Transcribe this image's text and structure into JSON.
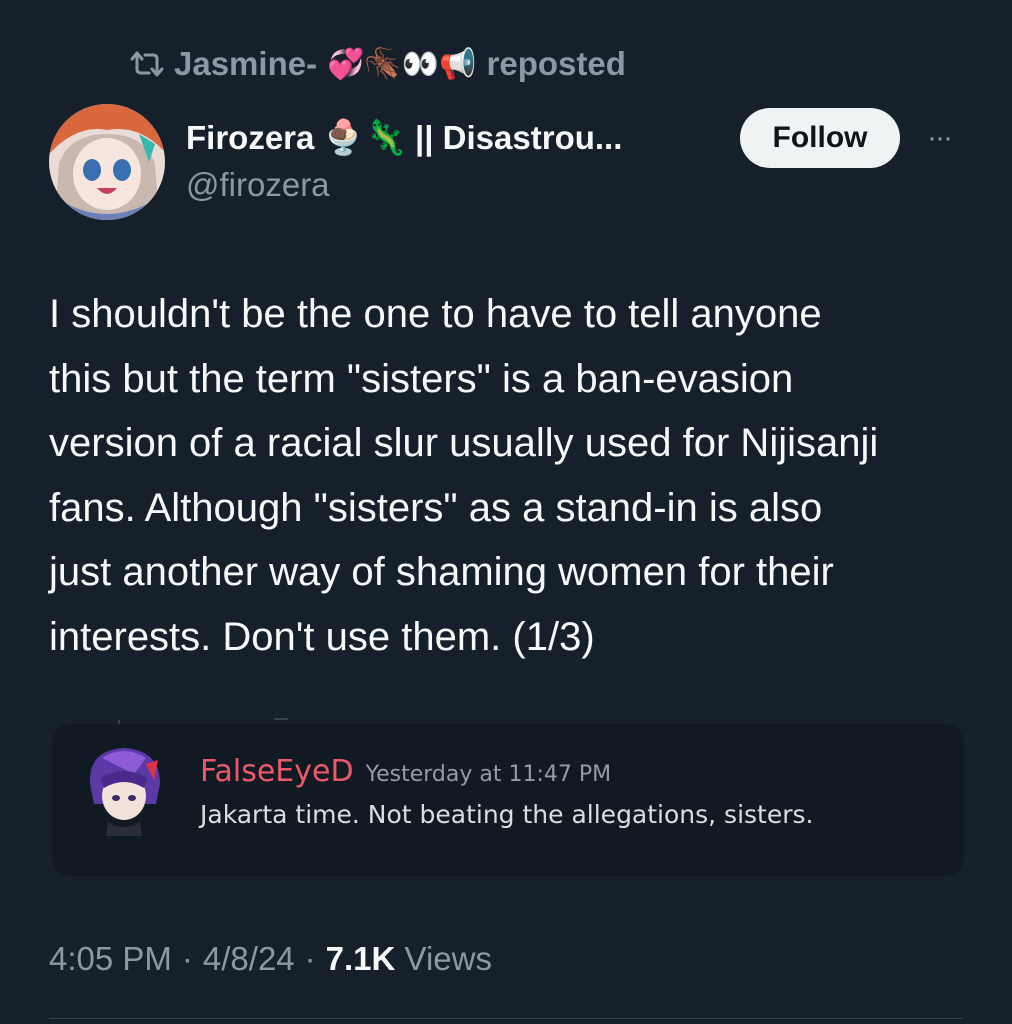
{
  "repost": {
    "reposter": "Jasmine-",
    "emojis": "💞🪳👀📢",
    "label": "reposted",
    "icon": "repost-icon"
  },
  "author": {
    "display_name": "Firozera",
    "name_emojis": "🍨🦎",
    "name_suffix": "|| Disastrou...",
    "handle": "@firozera"
  },
  "actions": {
    "follow_label": "Follow",
    "more_label": "···"
  },
  "tweet": {
    "lines": [
      "I shouldn't be the one to have to tell anyone",
      "this but the term \"sisters\" is a ban-evasion",
      "version of a racial slur usually used for Nijisanji",
      "fans. Although \"sisters\" as a stand-in is also",
      "just another way of shaming women for their",
      "interests. Don't use them. (1/3)"
    ]
  },
  "embed": {
    "username": "FalseEyeD",
    "timestamp": "Yesterday at 11:47 PM",
    "message": "Jakarta time. Not beating the allegations, sisters.",
    "username_color": "#ec5a6a"
  },
  "meta": {
    "time": "4:05 PM",
    "separator": "·",
    "date": "4/8/24",
    "views_count": "7.1K",
    "views_label": "Views"
  },
  "colors": {
    "background": "#15202b",
    "primary_text": "#f7f9f9",
    "secondary_text": "#8b98a5",
    "embed_background": "#111a23"
  }
}
